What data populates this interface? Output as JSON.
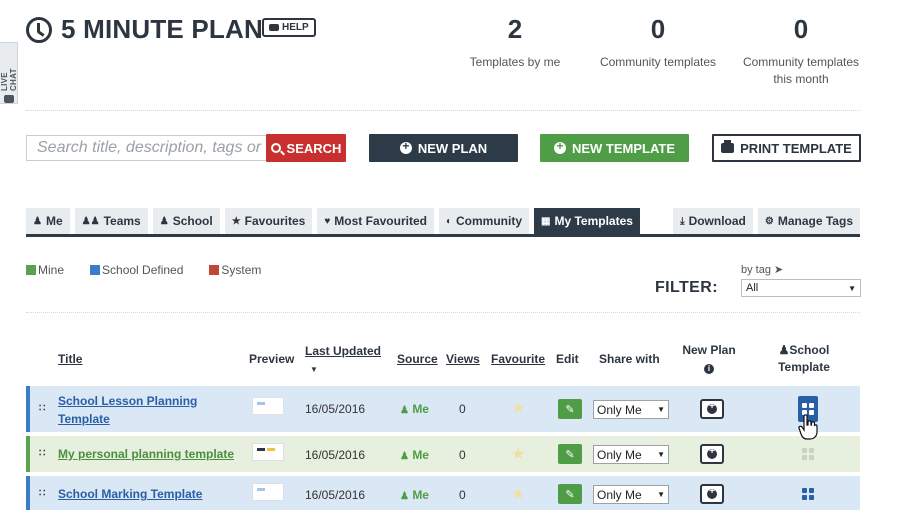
{
  "livechat": {
    "label": "LIVE CHAT"
  },
  "header": {
    "title": "5 MINUTE PLAN",
    "help_label": "HELP",
    "stats": [
      {
        "value": "2",
        "label": "Templates by me"
      },
      {
        "value": "0",
        "label": "Community templates"
      },
      {
        "value": "0",
        "label": "Community templates this month"
      }
    ]
  },
  "toolbar": {
    "search_placeholder": "Search title, description, tags or c",
    "search_label": "SEARCH",
    "new_plan_label": "NEW PLAN",
    "new_template_label": "NEW TEMPLATE",
    "print_template_label": "PRINT TEMPLATE"
  },
  "tabs": [
    {
      "label": "Me",
      "icon": "user-icon"
    },
    {
      "label": "Teams",
      "icon": "users-icon"
    },
    {
      "label": "School",
      "icon": "group-icon"
    },
    {
      "label": "Favourites",
      "icon": "star-icon"
    },
    {
      "label": "Most Favourited",
      "icon": "heart-icon"
    },
    {
      "label": "Community",
      "icon": "globe-icon"
    },
    {
      "label": "My Templates",
      "icon": "grid-icon",
      "active": true
    }
  ],
  "tabs_right": [
    {
      "label": "Download",
      "icon": "download-icon"
    },
    {
      "label": "Manage Tags",
      "icon": "gear-icon"
    }
  ],
  "legend": [
    {
      "label": "Mine",
      "color": "#5aa34e"
    },
    {
      "label": "School Defined",
      "color": "#3a7dc9"
    },
    {
      "label": "System",
      "color": "#c0473a"
    }
  ],
  "filter": {
    "label": "FILTER:",
    "bytag_label": "by tag",
    "selected": "All"
  },
  "table": {
    "headers": {
      "title": "Title",
      "preview": "Preview",
      "last_updated": "Last Updated",
      "source": "Source",
      "views": "Views",
      "favourite": "Favourite",
      "edit": "Edit",
      "share_with": "Share with",
      "new_plan": "New Plan",
      "school": "School",
      "template": "Template"
    },
    "rows": [
      {
        "title": "School Lesson Planning Template",
        "date": "16/05/2016",
        "source": "Me",
        "views": "0",
        "share": "Only Me",
        "type": "school"
      },
      {
        "title": "My personal planning template",
        "date": "16/05/2016",
        "source": "Me",
        "views": "0",
        "share": "Only Me",
        "type": "mine"
      },
      {
        "title": "School Marking Template",
        "date": "16/05/2016",
        "source": "Me",
        "views": "0",
        "share": "Only Me",
        "type": "school"
      }
    ]
  }
}
